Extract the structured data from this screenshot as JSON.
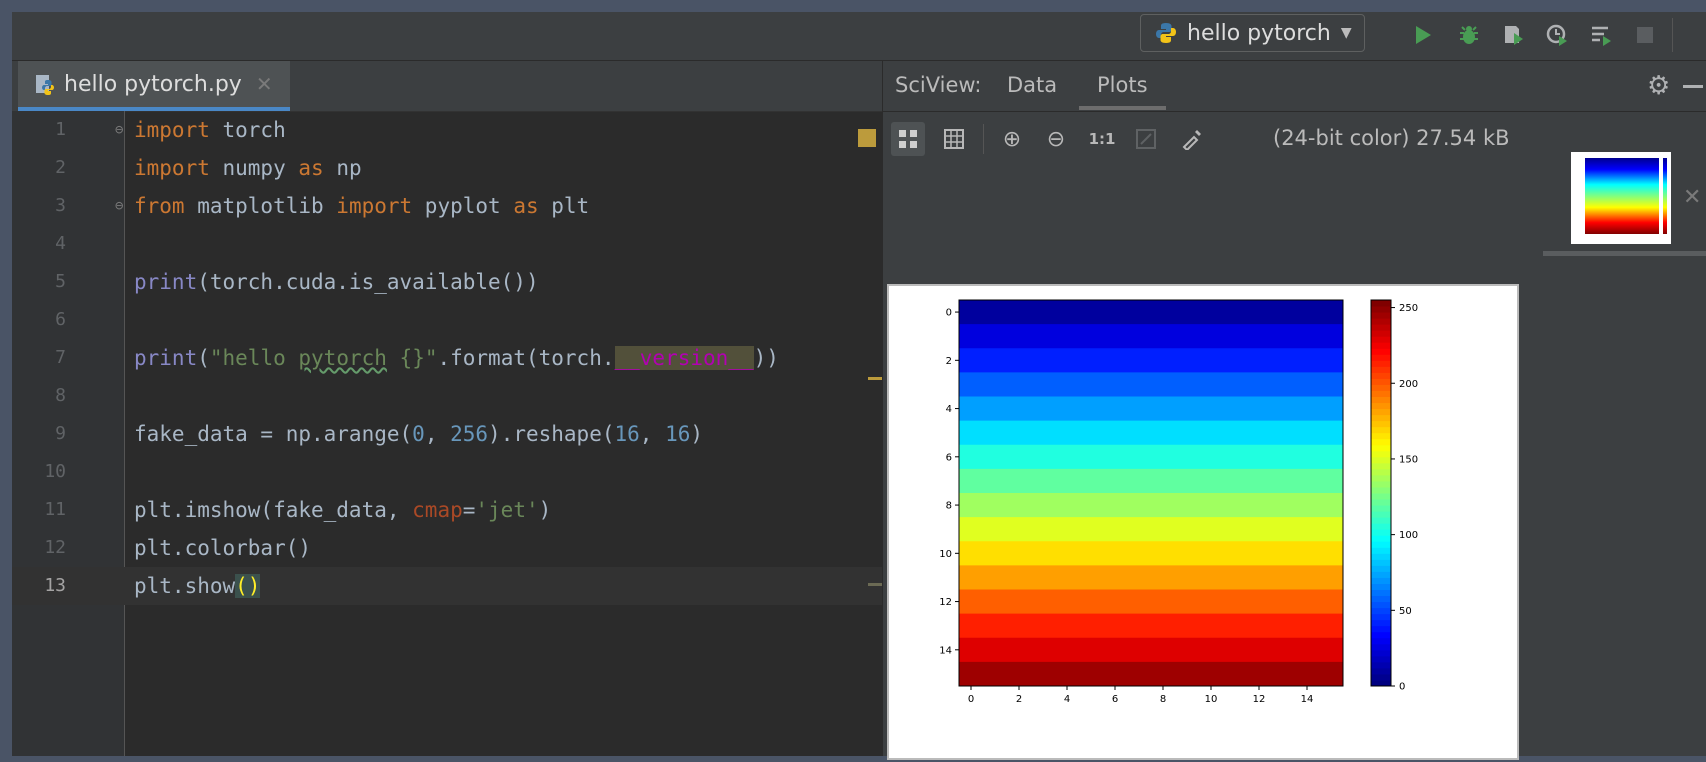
{
  "run_config": {
    "label": "hello pytorch",
    "icon": "python-icon"
  },
  "toolbar": {
    "icons": [
      "run-icon",
      "debug-icon",
      "coverage-icon",
      "profile-icon",
      "concurrency-icon",
      "stop-icon"
    ]
  },
  "editor": {
    "tab_label": "hello pytorch.py",
    "current_line": 13,
    "line_numbers": [
      "1",
      "2",
      "3",
      "4",
      "5",
      "6",
      "7",
      "8",
      "9",
      "10",
      "11",
      "12",
      "13"
    ]
  },
  "sciview": {
    "title": "SciView:",
    "tabs": [
      "Data",
      "Plots"
    ],
    "active_tab": "Plots",
    "image_info": "(24-bit color) 27.54 kB",
    "zoom_one_to_one": "1:1"
  },
  "chart_data": {
    "type": "heatmap",
    "colormap": "jet",
    "rows": 16,
    "cols": 16,
    "row_values": [
      7.5,
      23.5,
      39.5,
      55.5,
      71.5,
      87.5,
      103.5,
      119.5,
      135.5,
      151.5,
      167.5,
      183.5,
      199.5,
      215.5,
      231.5,
      247.5
    ],
    "x_ticks": [
      "0",
      "2",
      "4",
      "6",
      "8",
      "10",
      "12",
      "14"
    ],
    "y_ticks": [
      "0",
      "2",
      "4",
      "6",
      "8",
      "10",
      "12",
      "14"
    ],
    "colorbar_ticks": [
      "0",
      "50",
      "100",
      "150",
      "200",
      "250"
    ],
    "colorbar_range": [
      0,
      255
    ]
  }
}
